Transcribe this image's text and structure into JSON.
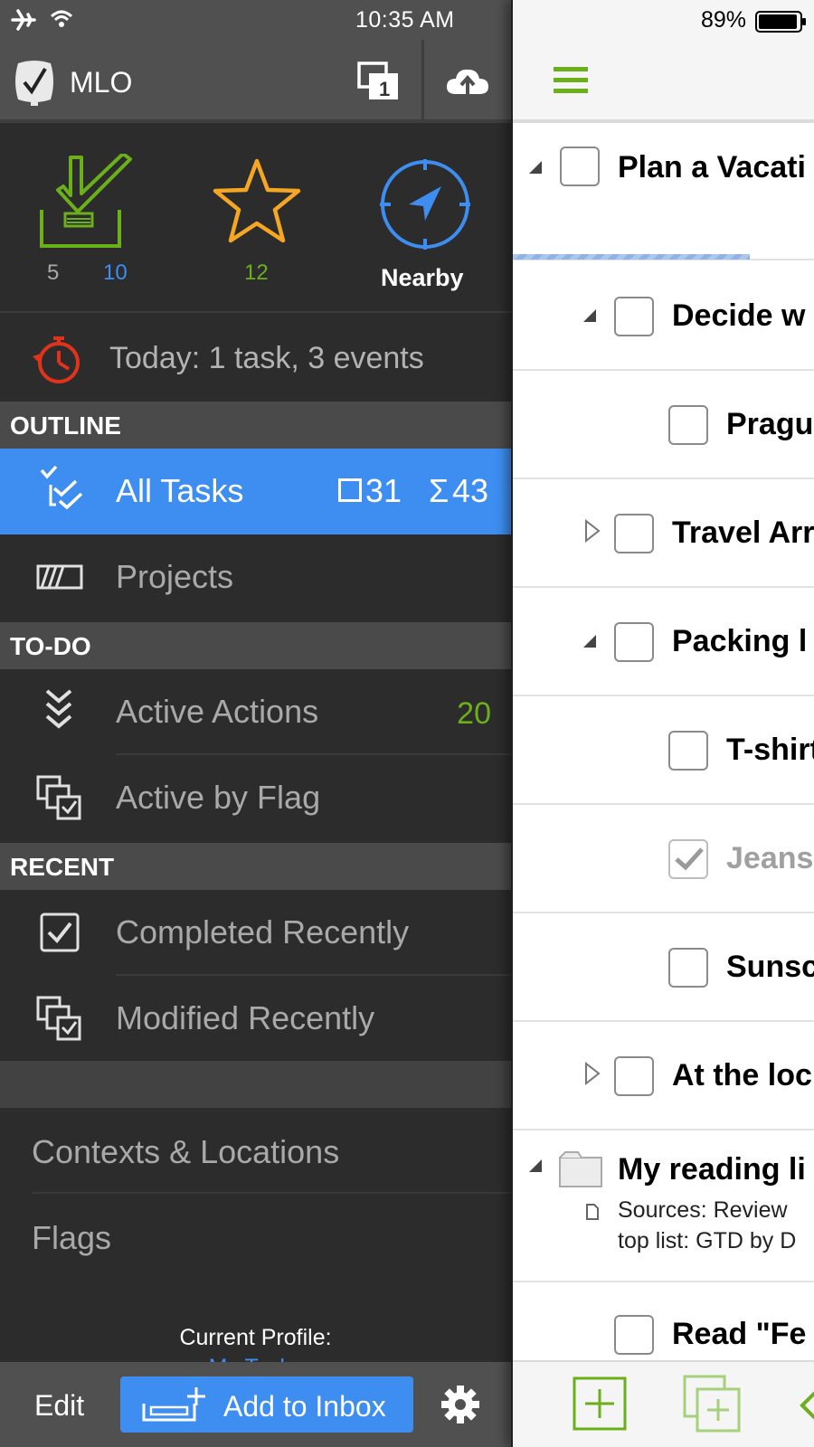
{
  "status": {
    "time": "10:35 AM",
    "battery": "89%"
  },
  "app": {
    "title": "MLO"
  },
  "quick": {
    "inbox_count_a": "5",
    "inbox_count_b": "10",
    "starred_count": "12",
    "nearby_label": "Nearby"
  },
  "today": {
    "text": "Today: 1 task, 3 events"
  },
  "sections": {
    "outline": "OUTLINE",
    "todo": "TO-DO",
    "recent": "RECENT"
  },
  "sidebar": {
    "all_tasks": {
      "label": "All Tasks",
      "count_open": "31",
      "count_total": "43"
    },
    "projects": {
      "label": "Projects"
    },
    "active_actions": {
      "label": "Active Actions",
      "count": "20"
    },
    "active_by_flag": {
      "label": "Active by Flag"
    },
    "completed_recently": {
      "label": "Completed Recently"
    },
    "modified_recently": {
      "label": "Modified Recently"
    },
    "contexts_locations": {
      "label": "Contexts & Locations"
    },
    "flags": {
      "label": "Flags"
    }
  },
  "profile": {
    "label": "Current Profile:",
    "name": "My Tasks"
  },
  "bottom_left": {
    "edit": "Edit",
    "add_to_inbox": "Add to Inbox"
  },
  "tasks": [
    {
      "title": "Plan a Vacati",
      "completed": false
    },
    {
      "title": "Decide w",
      "completed": false
    },
    {
      "title": "Pragu",
      "completed": false
    },
    {
      "title": "Travel Arr",
      "completed": false
    },
    {
      "title": "Packing l",
      "completed": false
    },
    {
      "title": "T-shirt",
      "completed": false
    },
    {
      "title": "Jeans",
      "completed": true
    },
    {
      "title": "Sunsc",
      "completed": false
    },
    {
      "title": "At the loc",
      "completed": false
    },
    {
      "title": "My reading li",
      "note_line1": "Sources: Review",
      "note_line2": "top list: GTD by D"
    },
    {
      "title": "Read \"Fe",
      "completed": false
    }
  ],
  "colors": {
    "accent_blue": "#3d8ef0",
    "green": "#6bb01b",
    "star_orange": "#f5a623",
    "timer_red": "#e0331c"
  }
}
